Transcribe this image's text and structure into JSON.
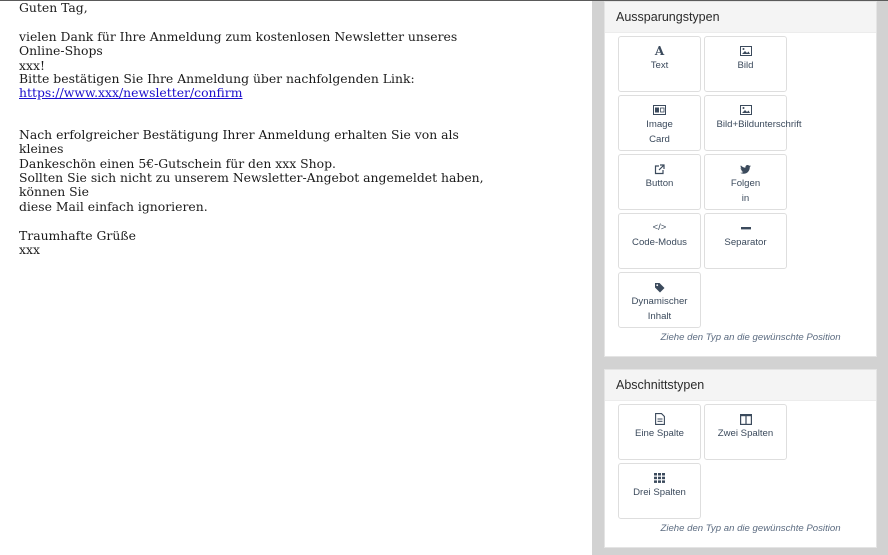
{
  "email": {
    "greeting": "Guten Tag,",
    "para1": "vielen Dank für Ihre Anmeldung zum kostenlosen Newsletter unseres Online-Shops\nxxx!",
    "para2": "Bitte bestätigen Sie Ihre Anmeldung über nachfolgenden Link:",
    "link": "https://www.xxx/newsletter/confirm",
    "para3": "Nach erfolgreicher Bestätigung Ihrer Anmeldung erhalten Sie von als kleines\nDankeschön einen 5€-Gutschein für den xxx Shop.",
    "para4": "Sollten Sie sich nicht zu unserem Newsletter-Angebot angemeldet haben, können Sie\ndiese Mail einfach ignorieren.",
    "closing": "Traumhafte Grüße",
    "signature": "xxx"
  },
  "sidebar": {
    "placeholder_panel": {
      "title": "Aussparungstypen",
      "tiles": [
        {
          "label": "Text",
          "icon": "text-icon"
        },
        {
          "label": "Bild",
          "icon": "image-icon"
        },
        {
          "label": "Image\nCard",
          "icon": "id-card-icon"
        },
        {
          "label": "Bild+Bildunterschrift",
          "icon": "image-caption-icon"
        },
        {
          "label": "Button",
          "icon": "external-link-icon"
        },
        {
          "label": "Folgen\nin\n...",
          "icon": "twitter-icon"
        },
        {
          "label": "Code-Modus",
          "icon": "code-icon"
        },
        {
          "label": "Separator",
          "icon": "minus-icon"
        },
        {
          "label": "Dynamischer\nInhalt",
          "icon": "tag-icon"
        }
      ],
      "hint": "Ziehe den Typ an die gewünschte Position"
    },
    "section_panel": {
      "title": "Abschnittstypen",
      "tiles": [
        {
          "label": "Eine Spalte",
          "icon": "file-icon"
        },
        {
          "label": "Zwei Spalten",
          "icon": "columns-icon"
        },
        {
          "label": "Drei Spalten",
          "icon": "grid-icon"
        }
      ],
      "hint": "Ziehe den Typ an die gewünschte Position"
    }
  }
}
